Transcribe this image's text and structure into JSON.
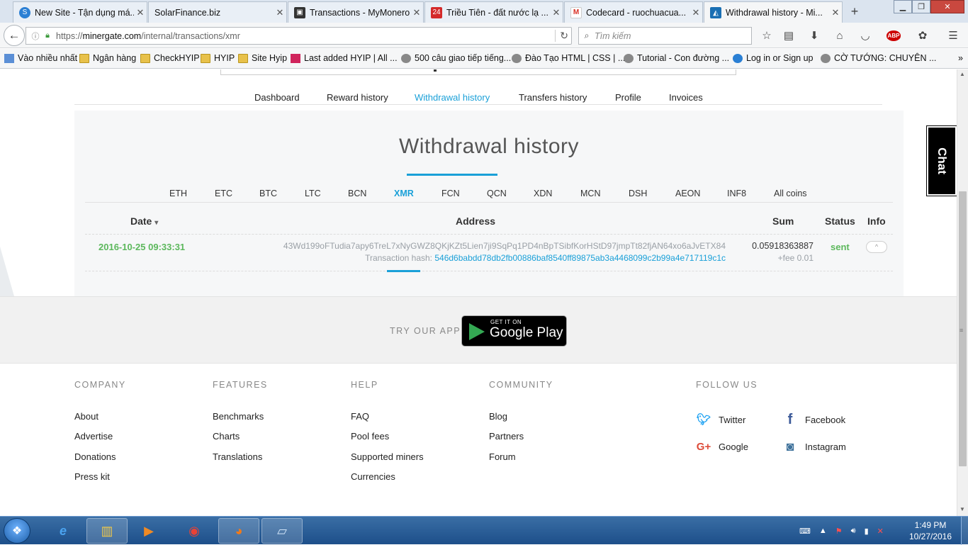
{
  "browser": {
    "tabs": [
      {
        "title": "New Site - Tận dụng má...",
        "active": false
      },
      {
        "title": "SolarFinance.biz",
        "active": false
      },
      {
        "title": "Transactions - MyMonero",
        "active": false
      },
      {
        "title": "Triều Tiên - đất nước lạ ...",
        "active": false
      },
      {
        "title": "Codecard - ruochuacua...",
        "active": false
      },
      {
        "title": "Withdrawal history - Mi...",
        "active": true
      }
    ],
    "new_tab": "+",
    "url_prefix": "https://",
    "url_domain": "minergate.com",
    "url_path": "/internal/transactions/xmr",
    "search_placeholder": "Tìm kiếm",
    "bookmarks": [
      "Vào nhiều nhất",
      "Ngân hàng",
      "CheckHYIP",
      "HYIP",
      "Site Hyip",
      "Last added HYIP | All ...",
      "500 câu giao tiếp tiếng...",
      "Đào Tạo HTML | CSS | ...",
      "Tutorial - Con đường ...",
      "Log in or Sign up",
      "CỜ TƯỚNG: CHUYÊN ..."
    ],
    "overflow": "»"
  },
  "subnav": {
    "items": [
      "Dashboard",
      "Reward history",
      "Withdrawal history",
      "Transfers history",
      "Profile",
      "Invoices"
    ],
    "active": "Withdrawal history"
  },
  "panel": {
    "title": "Withdrawal history",
    "coins": [
      "ETH",
      "ETC",
      "BTC",
      "LTC",
      "BCN",
      "XMR",
      "FCN",
      "QCN",
      "XDN",
      "MCN",
      "DSH",
      "AEON",
      "INF8",
      "All coins"
    ],
    "active_coin": "XMR",
    "headers": {
      "date": "Date",
      "sort": "▾",
      "address": "Address",
      "sum": "Sum",
      "status": "Status",
      "info": "Info"
    },
    "rows": [
      {
        "date": "2016-10-25 09:33:31",
        "address": "43Wd199oFTudia7apy6TreL7xNyGWZ8QKjKZt5Lien7ji9SqPq1PD4nBpTSibfKorHStD97jmpTt82fjAN64xo6aJvETX84",
        "hash_label": "Transaction hash:",
        "hash": "546d6babdd78db2fb00886baf8540ff89875ab3a4468099c2b99a4e717119c1c",
        "sum": "0.05918363887",
        "fee": "+fee 0.01",
        "status": "sent",
        "info_btn": "^"
      }
    ]
  },
  "chat": "Chat",
  "app_band": {
    "label": "TRY OUR APP",
    "store_small": "GET IT ON",
    "store_big": "Google Play"
  },
  "footer": {
    "company": {
      "title": "COMPANY",
      "links": [
        "About",
        "Advertise",
        "Donations",
        "Press kit"
      ]
    },
    "features": {
      "title": "FEATURES",
      "links": [
        "Benchmarks",
        "Charts",
        "Translations"
      ]
    },
    "help": {
      "title": "HELP",
      "links": [
        "FAQ",
        "Pool fees",
        "Supported miners",
        "Currencies"
      ]
    },
    "community": {
      "title": "COMMUNITY",
      "links": [
        "Blog",
        "Partners",
        "Forum"
      ]
    },
    "follow": {
      "title": "FOLLOW US",
      "links": [
        "Twitter",
        "Facebook",
        "Google",
        "Instagram"
      ]
    }
  },
  "taskbar": {
    "time": "1:49 PM",
    "date": "10/27/2016"
  },
  "colors": {
    "accent": "#1aa0d8",
    "success": "#5cb85c"
  }
}
